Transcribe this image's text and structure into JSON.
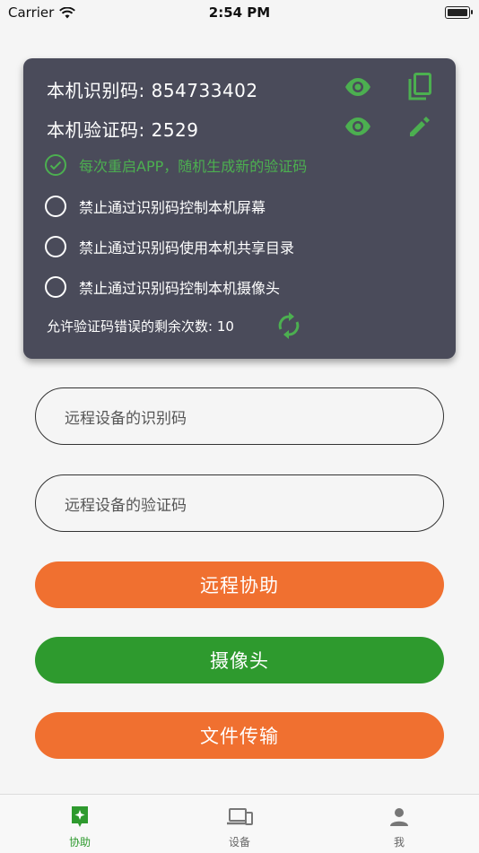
{
  "status_bar": {
    "carrier": "Carrier",
    "time": "2:54 PM"
  },
  "card": {
    "id_label": "本机识别码:",
    "id_value": "854733402",
    "verify_label": "本机验证码:",
    "verify_value": "2529",
    "options": [
      {
        "label": "每次重启APP，随机生成新的验证码",
        "checked": true
      },
      {
        "label": "禁止通过识别码控制本机屏幕",
        "checked": false
      },
      {
        "label": "禁止通过识别码使用本机共享目录",
        "checked": false
      },
      {
        "label": "禁止通过识别码控制本机摄像头",
        "checked": false
      }
    ],
    "retry_label": "允许验证码错误的剩余次数: 10"
  },
  "form": {
    "remote_id_placeholder": "远程设备的识别码",
    "remote_verify_placeholder": "远程设备的验证码"
  },
  "buttons": {
    "remote_assist": "远程协助",
    "camera": "摄像头",
    "file_transfer": "文件传输"
  },
  "tabs": [
    {
      "label": "协助",
      "icon": "assist-icon",
      "active": true
    },
    {
      "label": "设备",
      "icon": "devices-icon",
      "active": false
    },
    {
      "label": "我",
      "icon": "person-icon",
      "active": false
    }
  ],
  "colors": {
    "green": "#4caf50",
    "orange": "#f07030",
    "card": "#4a4b5a"
  }
}
